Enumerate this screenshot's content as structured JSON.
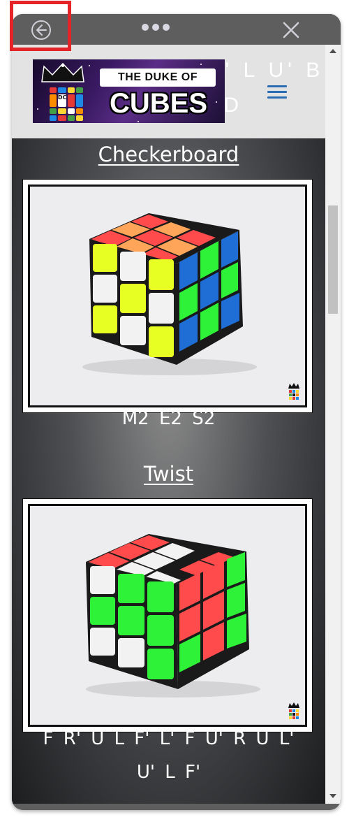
{
  "window": {
    "titlebar_color": "#5e5e5e",
    "back_icon": "back-arrow-circle-icon",
    "menu_icon": "more-dots-icon",
    "close_icon": "close-icon"
  },
  "highlight": {
    "color": "#e52427"
  },
  "header": {
    "logo_line1": "THE DUKE OF",
    "logo_line2": "CUBES",
    "logo_badge": "DC",
    "ghost_line1": "F' R' D' U' L U' B",
    "ghost_line2": "F U2 D",
    "menu_icon": "hamburger-menu-icon",
    "menu_color": "#2a6db5"
  },
  "patterns": [
    {
      "title": "Checkerboard",
      "algorithm": "M2  E2  S2"
    },
    {
      "title": "Twist",
      "algorithm_line1": "F  R'  U  L  F'  L'  F  U'  R  U  L'",
      "algorithm_line2": "U'  L  F'"
    }
  ],
  "colors": {
    "cube_red": "#ff4b4b",
    "cube_orange": "#ffa55a",
    "cube_yellow": "#e8ff23",
    "cube_green": "#2ef238",
    "cube_blue": "#1f6ed6",
    "cube_white": "#f2f2f2"
  }
}
